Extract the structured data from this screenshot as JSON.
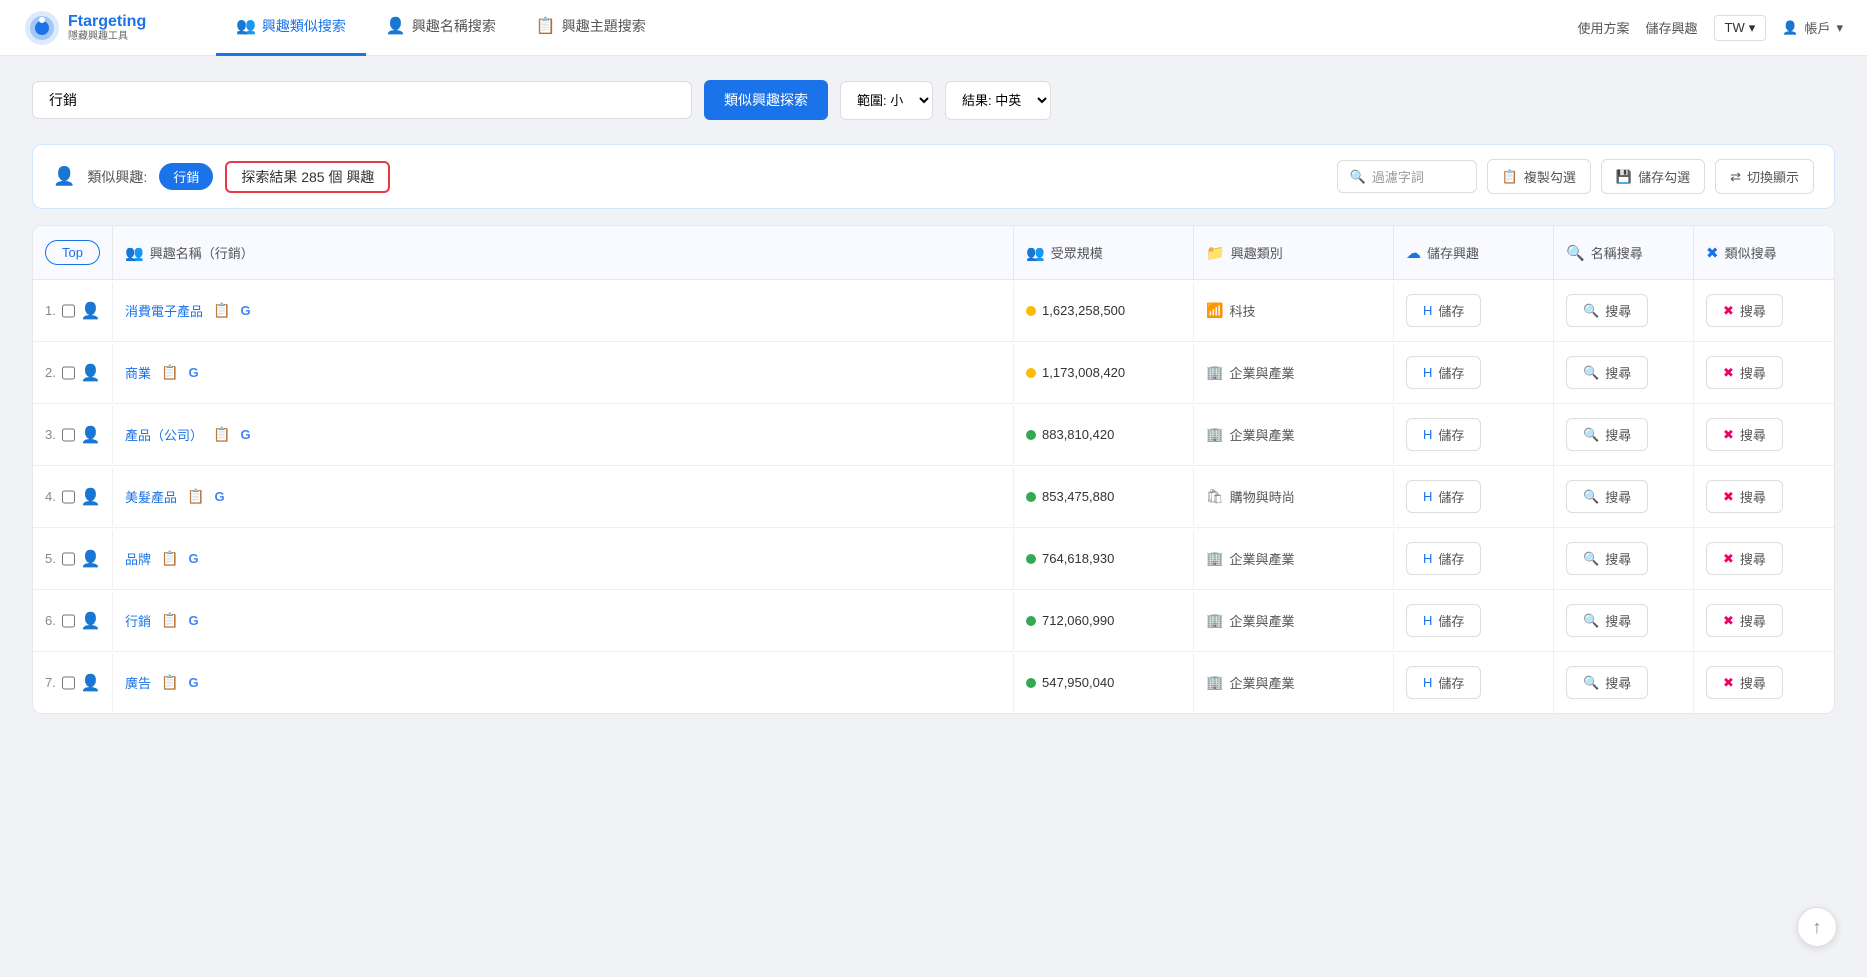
{
  "logo": {
    "title": "Ftargeting",
    "subtitle": "隱藏興趣工具"
  },
  "nav": {
    "tabs": [
      {
        "id": "similar",
        "label": "興趣類似搜索",
        "icon": "👥",
        "active": true
      },
      {
        "id": "name",
        "label": "興趣名稱搜索",
        "icon": "👤",
        "active": false
      },
      {
        "id": "topic",
        "label": "興趣主題搜索",
        "icon": "📋",
        "active": false
      }
    ]
  },
  "header_right": {
    "plan": "使用方案",
    "save": "儲存興趣",
    "region": "TW",
    "account": "帳戶"
  },
  "search": {
    "value": "行銷",
    "similar_btn": "類似興趣探索",
    "scope_label": "範圍: 小",
    "result_label": "結果: 中英"
  },
  "filter_bar": {
    "label": "類似興趣:",
    "tag": "行銷",
    "result_text": "探索結果 285 個 興趣",
    "filter_placeholder": "過濾字詞",
    "copy_btn": "複製勾選",
    "save_btn": "儲存勾選",
    "switch_btn": "切換顯示"
  },
  "table": {
    "top_label": "Top",
    "columns": [
      {
        "id": "rank",
        "label": ""
      },
      {
        "id": "name",
        "label": "興趣名稱（行銷）",
        "icon": "👥"
      },
      {
        "id": "audience",
        "label": "受眾規模",
        "icon": "👥"
      },
      {
        "id": "category",
        "label": "興趣類別",
        "icon": "📁"
      },
      {
        "id": "save",
        "label": "儲存興趣",
        "icon": "☁"
      },
      {
        "id": "name_search",
        "label": "名稱搜尋",
        "icon": "🔍"
      },
      {
        "id": "similar_search",
        "label": "類似搜尋",
        "icon": "✖"
      }
    ],
    "rows": [
      {
        "rank": "1.",
        "name": "消費電子產品",
        "audience_num": "1,623,258,500",
        "dot_color": "#fbbc05",
        "category": "科技",
        "category_icon": "wifi",
        "save_label": "儲存",
        "name_search_label": "搜尋",
        "similar_search_label": "搜尋"
      },
      {
        "rank": "2.",
        "name": "商業",
        "audience_num": "1,173,008,420",
        "dot_color": "#fbbc05",
        "category": "企業與產業",
        "category_icon": "building",
        "save_label": "儲存",
        "name_search_label": "搜尋",
        "similar_search_label": "搜尋"
      },
      {
        "rank": "3.",
        "name": "產品（公司）",
        "audience_num": "883,810,420",
        "dot_color": "#34a853",
        "category": "企業與產業",
        "category_icon": "building",
        "save_label": "儲存",
        "name_search_label": "搜尋",
        "similar_search_label": "搜尋"
      },
      {
        "rank": "4.",
        "name": "美髮產品",
        "audience_num": "853,475,880",
        "dot_color": "#34a853",
        "category": "購物與時尚",
        "category_icon": "shopping",
        "save_label": "儲存",
        "name_search_label": "搜尋",
        "similar_search_label": "搜尋"
      },
      {
        "rank": "5.",
        "name": "品牌",
        "audience_num": "764,618,930",
        "dot_color": "#34a853",
        "category": "企業與產業",
        "category_icon": "building",
        "save_label": "儲存",
        "name_search_label": "搜尋",
        "similar_search_label": "搜尋"
      },
      {
        "rank": "6.",
        "name": "行銷",
        "audience_num": "712,060,990",
        "dot_color": "#34a853",
        "category": "企業與產業",
        "category_icon": "building",
        "save_label": "儲存",
        "name_search_label": "搜尋",
        "similar_search_label": "搜尋"
      },
      {
        "rank": "7.",
        "name": "廣告",
        "audience_num": "547,950,040",
        "dot_color": "#34a853",
        "category": "企業與產業",
        "category_icon": "building",
        "save_label": "儲存",
        "name_search_label": "搜尋",
        "similar_search_label": "搜尋"
      }
    ]
  }
}
